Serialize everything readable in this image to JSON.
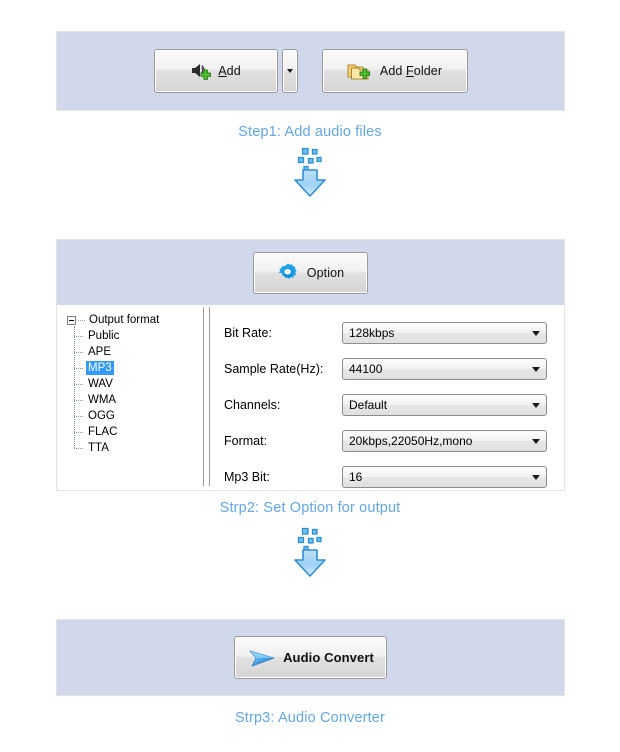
{
  "step1": {
    "buttons": {
      "add": {
        "label": "Add",
        "accel": "A",
        "icon": "speaker-add-icon"
      },
      "add_split": {
        "icon": "chevron-down-icon"
      },
      "add_folder_pre": "Add ",
      "add_folder_accel": "F",
      "add_folder_post": "older",
      "add_folder_label": "Add Folder",
      "add_folder_icon": "folder-add-icon"
    },
    "caption_num": "Step1:",
    "caption_text": "Add audio files",
    "arrow_icon": "download-arrow-icon"
  },
  "step2": {
    "option_button": {
      "label": "Option",
      "icon": "gear-icon"
    },
    "tree": {
      "root": "Output format",
      "items": [
        {
          "label": "Public",
          "selected": false
        },
        {
          "label": "APE",
          "selected": false
        },
        {
          "label": "MP3",
          "selected": true
        },
        {
          "label": "WAV",
          "selected": false
        },
        {
          "label": "WMA",
          "selected": false
        },
        {
          "label": "OGG",
          "selected": false
        },
        {
          "label": "FLAC",
          "selected": false
        },
        {
          "label": "TTA",
          "selected": false
        }
      ]
    },
    "fields": [
      {
        "label": "Bit Rate:",
        "value": "128kbps"
      },
      {
        "label": "Sample Rate(Hz):",
        "value": "44100"
      },
      {
        "label": "Channels:",
        "value": "Default"
      },
      {
        "label": "Format:",
        "value": "20kbps,22050Hz,mono"
      },
      {
        "label": "Mp3 Bit:",
        "value": "16"
      }
    ],
    "caption_num": "Strp2:",
    "caption_text": "Set Option for output",
    "arrow_icon": "download-arrow-icon"
  },
  "step3": {
    "convert_button": {
      "label": "Audio Convert",
      "icon": "play-arrow-icon"
    },
    "caption_num": "Strp3:",
    "caption_text": "Audio Converter"
  },
  "colors": {
    "panel_bg": "#d2d8ec",
    "caption_blue": "#63a7e8",
    "selection_blue": "#3399ff",
    "arrow_blue": "#2e8fd4"
  }
}
